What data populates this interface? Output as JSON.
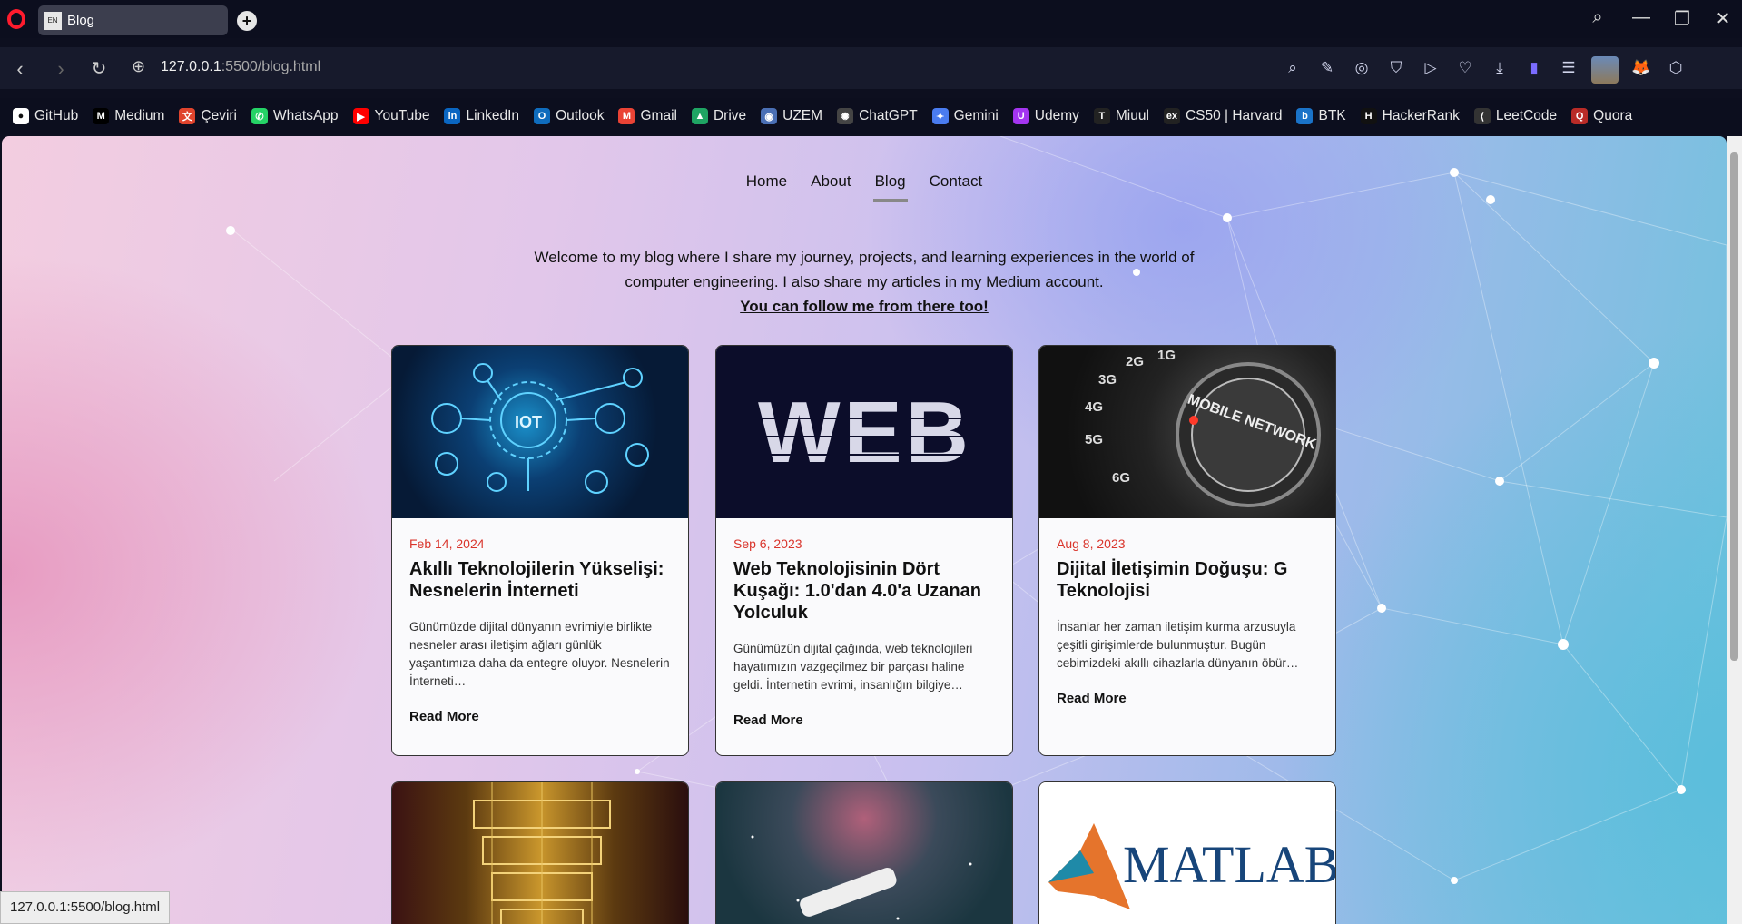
{
  "browser": {
    "tab_title": "Blog",
    "tab_favicon_text": "EN",
    "new_tab_symbol": "+",
    "url_host": "127.0.0.1",
    "url_path": ":5500/blog.html",
    "status_url": "127.0.0.1:5500/blog.html"
  },
  "bookmarks": [
    {
      "label": "GitHub",
      "icon": "github-icon",
      "color": "#ffffff",
      "glyph": "●"
    },
    {
      "label": "Medium",
      "icon": "medium-icon",
      "color": "#000000",
      "glyph": "M"
    },
    {
      "label": "Çeviri",
      "icon": "translate-icon",
      "color": "#e0442d",
      "glyph": "文"
    },
    {
      "label": "WhatsApp",
      "icon": "whatsapp-icon",
      "color": "#25d366",
      "glyph": "✆"
    },
    {
      "label": "YouTube",
      "icon": "youtube-icon",
      "color": "#ff0000",
      "glyph": "▶"
    },
    {
      "label": "LinkedIn",
      "icon": "linkedin-icon",
      "color": "#0a66c2",
      "glyph": "in"
    },
    {
      "label": "Outlook",
      "icon": "outlook-icon",
      "color": "#0f6cbd",
      "glyph": "O"
    },
    {
      "label": "Gmail",
      "icon": "gmail-icon",
      "color": "#ea4335",
      "glyph": "M"
    },
    {
      "label": "Drive",
      "icon": "drive-icon",
      "color": "#1fa463",
      "glyph": "▲"
    },
    {
      "label": "UZEM",
      "icon": "uzem-icon",
      "color": "#4a6fb5",
      "glyph": "◉"
    },
    {
      "label": "ChatGPT",
      "icon": "chatgpt-icon",
      "color": "#444444",
      "glyph": "✺"
    },
    {
      "label": "Gemini",
      "icon": "gemini-icon",
      "color": "#4a7cf0",
      "glyph": "✦"
    },
    {
      "label": "Udemy",
      "icon": "udemy-icon",
      "color": "#a435f0",
      "glyph": "U"
    },
    {
      "label": "Miuul",
      "icon": "miuul-icon",
      "color": "#222222",
      "glyph": "T"
    },
    {
      "label": "CS50 | Harvard",
      "icon": "edx-icon",
      "color": "#222222",
      "glyph": "ex"
    },
    {
      "label": "BTK",
      "icon": "btk-icon",
      "color": "#1a73c8",
      "glyph": "b"
    },
    {
      "label": "HackerRank",
      "icon": "hackerrank-icon",
      "color": "#111111",
      "glyph": "H"
    },
    {
      "label": "LeetCode",
      "icon": "leetcode-icon",
      "color": "#333333",
      "glyph": "⟨"
    },
    {
      "label": "Quora",
      "icon": "quora-icon",
      "color": "#b92b27",
      "glyph": "Q"
    }
  ],
  "nav": {
    "home": "Home",
    "about": "About",
    "blog": "Blog",
    "contact": "Contact"
  },
  "intro": {
    "line1": "Welcome to my blog where I share my journey, projects, and learning experiences in the world of computer engineering. I also share my articles in my Medium account.",
    "follow": "You can follow me from there too!"
  },
  "posts": [
    {
      "date": "Feb 14, 2024",
      "title": "Akıllı Teknolojilerin Yükselişi: Nesnelerin İnterneti",
      "desc": "Günümüzde dijital dünyanın evrimiyle birlikte nesneler arası iletişim ağları günlük yaşantımıza daha da entegre oluyor. Nesnelerin İnterneti…",
      "read_more": "Read More",
      "image_text": "IOT"
    },
    {
      "date": "Sep 6, 2023",
      "title": "Web Teknolojisinin Dört Kuşağı: 1.0'dan 4.0'a Uzanan Yolculuk",
      "desc": "Günümüzün dijital çağında, web teknolojileri hayatımızın vazgeçilmez bir parçası haline geldi. İnternetin evrimi, insanlığın bilgiye…",
      "read_more": "Read More",
      "image_text": "WEB"
    },
    {
      "date": "Aug 8, 2023",
      "title": "Dijital İletişimin Doğuşu: G Teknolojisi",
      "desc": "İnsanlar her zaman iletişim kurma arzusuyla çeşitli girişimlerde bulunmuştur. Bugün cebimizdeki akıllı cihazlarla dünyanın öbür…",
      "read_more": "Read More",
      "image_text": "MOBILE NETWORK",
      "dial_labels": [
        "2G",
        "1G",
        "3G",
        "4G",
        "5G",
        "6G"
      ]
    }
  ],
  "second_row": [
    {
      "image": "quantum-computer-image"
    },
    {
      "image": "telescope-galaxy-image"
    },
    {
      "image_text": "MATLAB"
    }
  ]
}
